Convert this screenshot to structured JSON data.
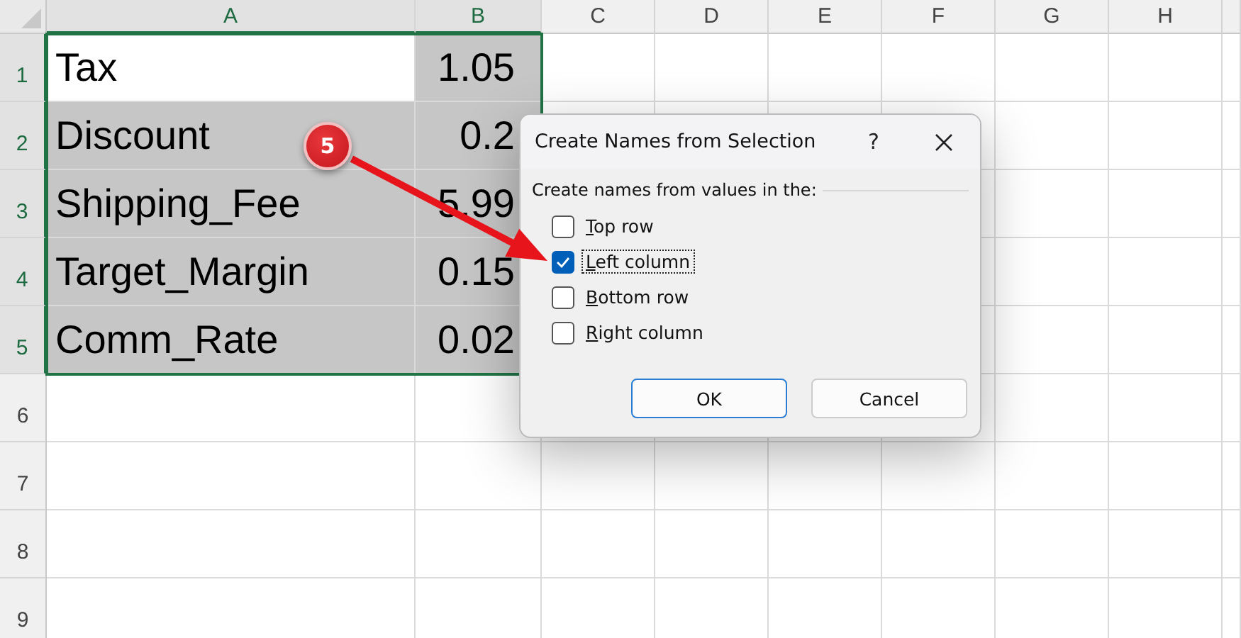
{
  "sheet": {
    "columns": [
      {
        "label": "A",
        "selected": true
      },
      {
        "label": "B",
        "selected": true
      },
      {
        "label": "C",
        "selected": false
      },
      {
        "label": "D",
        "selected": false
      },
      {
        "label": "E",
        "selected": false
      },
      {
        "label": "F",
        "selected": false
      },
      {
        "label": "G",
        "selected": false
      },
      {
        "label": "H",
        "selected": false
      }
    ],
    "rows": [
      {
        "number": "1",
        "selected": true,
        "cells": [
          {
            "text": "Tax",
            "highlighted": false
          },
          {
            "text": "1.05",
            "highlighted": true
          }
        ]
      },
      {
        "number": "2",
        "selected": true,
        "cells": [
          {
            "text": "Discount",
            "highlighted": true
          },
          {
            "text": "0.2",
            "highlighted": true
          }
        ]
      },
      {
        "number": "3",
        "selected": true,
        "cells": [
          {
            "text": "Shipping_Fee",
            "highlighted": true
          },
          {
            "text": "5.99",
            "highlighted": true
          }
        ]
      },
      {
        "number": "4",
        "selected": true,
        "cells": [
          {
            "text": "Target_Margin",
            "highlighted": true
          },
          {
            "text": "0.15",
            "highlighted": true
          }
        ]
      },
      {
        "number": "5",
        "selected": true,
        "cells": [
          {
            "text": "Comm_Rate",
            "highlighted": true
          },
          {
            "text": "0.02",
            "highlighted": true
          }
        ]
      },
      {
        "number": "6",
        "selected": false
      },
      {
        "number": "7",
        "selected": false
      },
      {
        "number": "8",
        "selected": false
      },
      {
        "number": "9",
        "selected": false
      }
    ]
  },
  "callout": {
    "number": "5"
  },
  "dialog": {
    "title": "Create Names from Selection",
    "help": "?",
    "group_label": "Create names from values in the:",
    "options": [
      {
        "label": "Top row",
        "checked": false,
        "focused": false
      },
      {
        "label": "Left column",
        "checked": true,
        "focused": true
      },
      {
        "label": "Bottom row",
        "checked": false,
        "focused": false
      },
      {
        "label": "Right column",
        "checked": false,
        "focused": false
      }
    ],
    "buttons": [
      {
        "label": "OK",
        "default": true
      },
      {
        "label": "Cancel",
        "default": false
      }
    ]
  }
}
